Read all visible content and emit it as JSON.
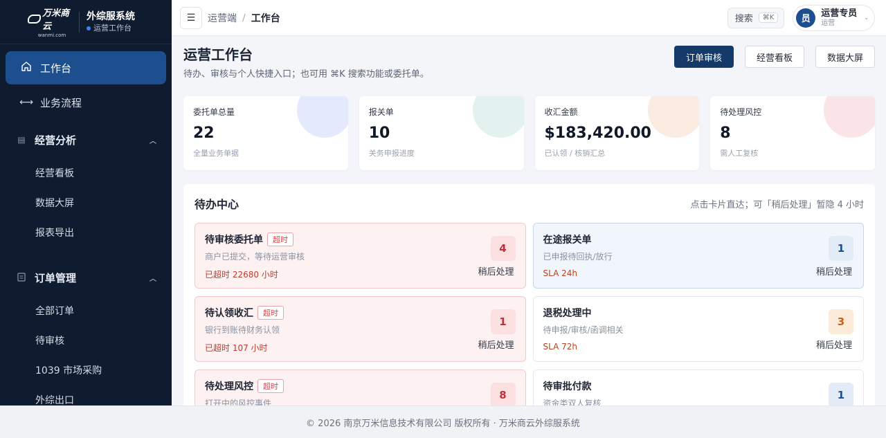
{
  "brand": {
    "logo_text": "万米商云",
    "logo_sub": "wanmi.com",
    "title": "外综服系统",
    "subtitle": "运营工作台"
  },
  "sidebar": {
    "items": [
      {
        "label": "工作台",
        "icon": "home-icon",
        "active": true
      },
      {
        "label": "业务流程",
        "icon": "arrows-icon",
        "active": false
      }
    ],
    "groups": [
      {
        "label": "经营分析",
        "icon": "chart-icon",
        "children": [
          "经营看板",
          "数据大屏",
          "报表导出"
        ]
      },
      {
        "label": "订单管理",
        "icon": "clipboard-icon",
        "children": [
          "全部订单",
          "待审核",
          "1039 市场采购",
          "外综出口"
        ]
      }
    ]
  },
  "topbar": {
    "breadcrumb_root": "运营端",
    "breadcrumb_sep": "/",
    "breadcrumb_current": "工作台",
    "search_label": "搜索",
    "search_shortcut": "⌘K",
    "user_avatar": "员",
    "user_name": "运营专员",
    "user_role": "运营"
  },
  "page": {
    "title": "运营工作台",
    "description": "待办、审核与个人快捷入口；也可用 ⌘K 搜索功能或委托单。",
    "actions": [
      "订单审核",
      "经营看板",
      "数据大屏"
    ]
  },
  "stats": [
    {
      "label": "委托单总量",
      "value": "22",
      "note": "全量业务单据",
      "color": "#e4e9fb"
    },
    {
      "label": "报关单",
      "value": "10",
      "note": "关务申报进度",
      "color": "#e3f2ee"
    },
    {
      "label": "收汇金额",
      "value": "$183,420.00",
      "note": "已认领 / 核销汇总",
      "color": "#fcebe1"
    },
    {
      "label": "待处理风控",
      "value": "8",
      "note": "需人工复核",
      "color": "#fbe4e8"
    }
  ],
  "todo": {
    "title": "待办中心",
    "tip": "点击卡片直达；可「稍后处理」暂隐 4 小时",
    "later_label": "稍后处理",
    "overdue_tag": "超时",
    "cards": [
      {
        "title": "待审核委托单",
        "overdue": true,
        "desc": "商户已提交，等待运营审核",
        "sla": "已超时 22680 小时",
        "count": "4",
        "variant": "overdue",
        "badge": "red"
      },
      {
        "title": "在途报关单",
        "overdue": false,
        "desc": "已申报待回执/放行",
        "sla": "SLA 24h",
        "count": "1",
        "variant": "info",
        "badge": "blue"
      },
      {
        "title": "待认领收汇",
        "overdue": true,
        "desc": "银行到账待财务认领",
        "sla": "已超时 107 小时",
        "count": "1",
        "variant": "overdue",
        "badge": "red"
      },
      {
        "title": "退税处理中",
        "overdue": false,
        "desc": "待申报/审核/函调相关",
        "sla": "SLA 72h",
        "count": "3",
        "variant": "plain",
        "badge": "orange"
      },
      {
        "title": "待处理风控",
        "overdue": true,
        "desc": "打开中的风控事件",
        "sla": "",
        "count": "8",
        "variant": "overdue",
        "badge": "red"
      },
      {
        "title": "待审批付款",
        "overdue": false,
        "desc": "资金类双人复核",
        "sla": "",
        "count": "1",
        "variant": "plain",
        "badge": "blue"
      }
    ]
  },
  "footer": {
    "text": "© 2026 南京万米信息技术有限公司 版权所有 · 万米商云外综服系统"
  }
}
